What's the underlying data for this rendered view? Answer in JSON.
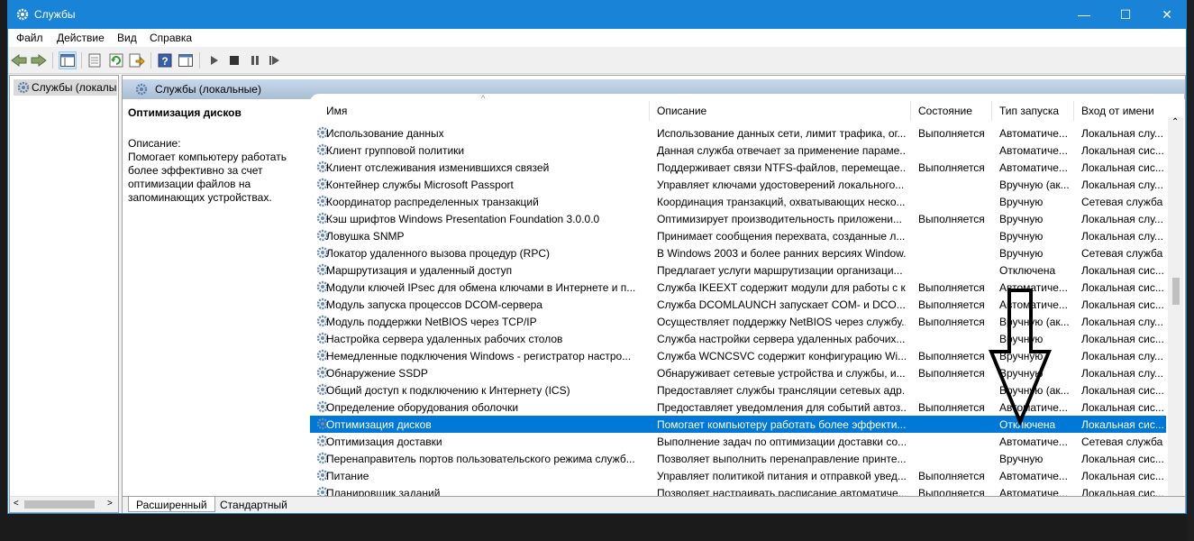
{
  "window": {
    "title": "Службы",
    "controls": {
      "minimize": "—",
      "maximize": "☐",
      "close": "✕"
    }
  },
  "menu": [
    "Файл",
    "Действие",
    "Вид",
    "Справка"
  ],
  "toolbar": {
    "icons": [
      "back-arrow-icon",
      "forward-arrow-icon",
      "console-tree-icon",
      "properties-icon",
      "refresh-icon",
      "export-list-icon",
      "help-icon",
      "show-action-pane-icon",
      "play-icon",
      "stop-icon",
      "pause-icon",
      "restart-icon"
    ]
  },
  "tree": {
    "root_label": "Службы (локалы"
  },
  "pane": {
    "header": "Службы (локальные)"
  },
  "description": {
    "title": "Оптимизация дисков",
    "label": "Описание:",
    "text": "Помогает компьютеру работать более эффективно за счет оптимизации файлов на запоминающих устройствах."
  },
  "columns": {
    "name": "Имя",
    "description": "Описание",
    "status": "Состояние",
    "startup": "Тип запуска",
    "logon": "Вход от имени"
  },
  "services": [
    {
      "name": "Использование данных",
      "desc": "Использование данных сети, лимит трафика, ог...",
      "status": "Выполняется",
      "startup": "Автоматиче...",
      "logon": "Локальная слу..."
    },
    {
      "name": "Клиент групповой политики",
      "desc": "Данная служба отвечает за применение параме...",
      "status": "",
      "startup": "Автоматиче...",
      "logon": "Локальная сис..."
    },
    {
      "name": "Клиент отслеживания изменившихся связей",
      "desc": "Поддерживает связи NTFS-файлов, перемещае...",
      "status": "Выполняется",
      "startup": "Автоматиче...",
      "logon": "Локальная сис..."
    },
    {
      "name": "Контейнер службы Microsoft Passport",
      "desc": "Управляет ключами удостоверений локального...",
      "status": "",
      "startup": "Вручную (ак...",
      "logon": "Локальная слу..."
    },
    {
      "name": "Координатор распределенных транзакций",
      "desc": "Координация транзакций, охватывающих неско...",
      "status": "",
      "startup": "Вручную",
      "logon": "Сетевая служба"
    },
    {
      "name": "Кэш шрифтов Windows Presentation Foundation 3.0.0.0",
      "desc": "Оптимизирует производительность приложени...",
      "status": "Выполняется",
      "startup": "Вручную",
      "logon": "Локальная слу..."
    },
    {
      "name": "Ловушка SNMP",
      "desc": "Принимает сообщения перехвата, созданные л...",
      "status": "",
      "startup": "Вручную",
      "logon": "Локальная слу..."
    },
    {
      "name": "Локатор удаленного вызова процедур (RPC)",
      "desc": "В Windows 2003 и более ранних версиях Window...",
      "status": "",
      "startup": "Вручную",
      "logon": "Сетевая служба"
    },
    {
      "name": "Маршрутизация и удаленный доступ",
      "desc": "Предлагает услуги маршрутизации организаци...",
      "status": "",
      "startup": "Отключена",
      "logon": "Локальная сис..."
    },
    {
      "name": "Модули ключей IPsec для обмена ключами в Интернете и п...",
      "desc": "Служба IKEEXT содержит модули для работы с к...",
      "status": "Выполняется",
      "startup": "Автоматиче...",
      "logon": "Локальная сис..."
    },
    {
      "name": "Модуль запуска процессов DCOM-сервера",
      "desc": "Служба DCOMLAUNCH запускает COM- и DCO...",
      "status": "Выполняется",
      "startup": "Автоматиче...",
      "logon": "Локальная сис..."
    },
    {
      "name": "Модуль поддержки NetBIOS через TCP/IP",
      "desc": "Осуществляет поддержку NetBIOS через службу...",
      "status": "Выполняется",
      "startup": "Вручную (ак...",
      "logon": "Локальная слу..."
    },
    {
      "name": "Настройка сервера удаленных рабочих столов",
      "desc": "Служба настройки сервера удаленных рабочих...",
      "status": "",
      "startup": "Вручную",
      "logon": "Локальная сис..."
    },
    {
      "name": "Немедленные подключения Windows - регистратор настро...",
      "desc": "Служба WCNCSVC содержит конфигурацию Wi...",
      "status": "Выполняется",
      "startup": "Вручную",
      "logon": "Локальная слу..."
    },
    {
      "name": "Обнаружение SSDP",
      "desc": "Обнаруживает сетевые устройства и службы, и...",
      "status": "Выполняется",
      "startup": "Вручную",
      "logon": "Локальная слу..."
    },
    {
      "name": "Общий доступ к подключению к Интернету (ICS)",
      "desc": "Предоставляет службы трансляции сетевых адр...",
      "status": "",
      "startup": "Вручную (ак...",
      "logon": "Локальная сис..."
    },
    {
      "name": "Определение оборудования оболочки",
      "desc": "Предоставляет уведомления для событий автоз...",
      "status": "Выполняется",
      "startup": "Автоматиче...",
      "logon": "Локальная сис..."
    },
    {
      "name": "Оптимизация дисков",
      "desc": "Помогает компьютеру работать более эффекти...",
      "status": "",
      "startup": "Отключена",
      "logon": "Локальная сис...",
      "selected": true
    },
    {
      "name": "Оптимизация доставки",
      "desc": "Выполнение задач по оптимизации доставки со...",
      "status": "",
      "startup": "Автоматиче...",
      "logon": "Сетевая служба"
    },
    {
      "name": "Перенаправитель портов пользовательского режима служб...",
      "desc": "Позволяет выполнить перенаправление принте...",
      "status": "",
      "startup": "Вручную",
      "logon": "Локальная сис..."
    },
    {
      "name": "Питание",
      "desc": "Управляет политикой питания и отправкой увед...",
      "status": "Выполняется",
      "startup": "Автоматиче...",
      "logon": "Локальная сис..."
    },
    {
      "name": "Планировщик заданий",
      "desc": "Позволяет настраивать расписание автоматиче...",
      "status": "Выполняется",
      "startup": "Автоматиче...",
      "logon": "Локальная сис..."
    }
  ],
  "tabs": {
    "extended": "Расширенный",
    "standard": "Стандартный"
  },
  "colors": {
    "titlebar": "#1883d7",
    "selection": "#0078d7",
    "pane_header": "#b7c9de"
  }
}
